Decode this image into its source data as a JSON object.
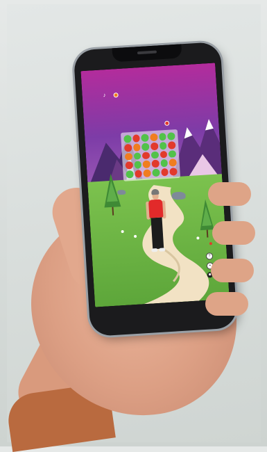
{
  "scene": {
    "description_tag": "",
    "colors": {
      "sky_top": "#b32c9c",
      "sky_bottom": "#9b5ab5",
      "grass": "#7cc24e",
      "path": "#f2e2c4",
      "shirt": "#e22a2a",
      "sleeve": "#b96a3f"
    }
  },
  "game": {
    "sound_icon": "speaker-icon",
    "status_text": "",
    "board_label": "",
    "board": {
      "rows": 5,
      "cols": 6,
      "cells": [
        [
          "green",
          "red",
          "green",
          "orange",
          "green",
          "green"
        ],
        [
          "red",
          "orange",
          "green",
          "red",
          "green",
          "red"
        ],
        [
          "orange",
          "green",
          "red",
          "green",
          "red",
          "green"
        ],
        [
          "red",
          "green",
          "orange",
          "red",
          "green",
          "orange"
        ],
        [
          "green",
          "red",
          "orange",
          "green",
          "red",
          "red"
        ]
      ],
      "palette": {
        "green": "#52c24a",
        "red": "#e23a2c",
        "orange": "#f07d20"
      }
    },
    "side_buttons": [
      {
        "name": "help",
        "glyph": "?",
        "icon": "question-icon"
      },
      {
        "name": "hint",
        "glyph": "•",
        "icon": "lightbulb-icon"
      },
      {
        "name": "lock",
        "glyph": "■",
        "icon": "lock-icon"
      }
    ]
  }
}
